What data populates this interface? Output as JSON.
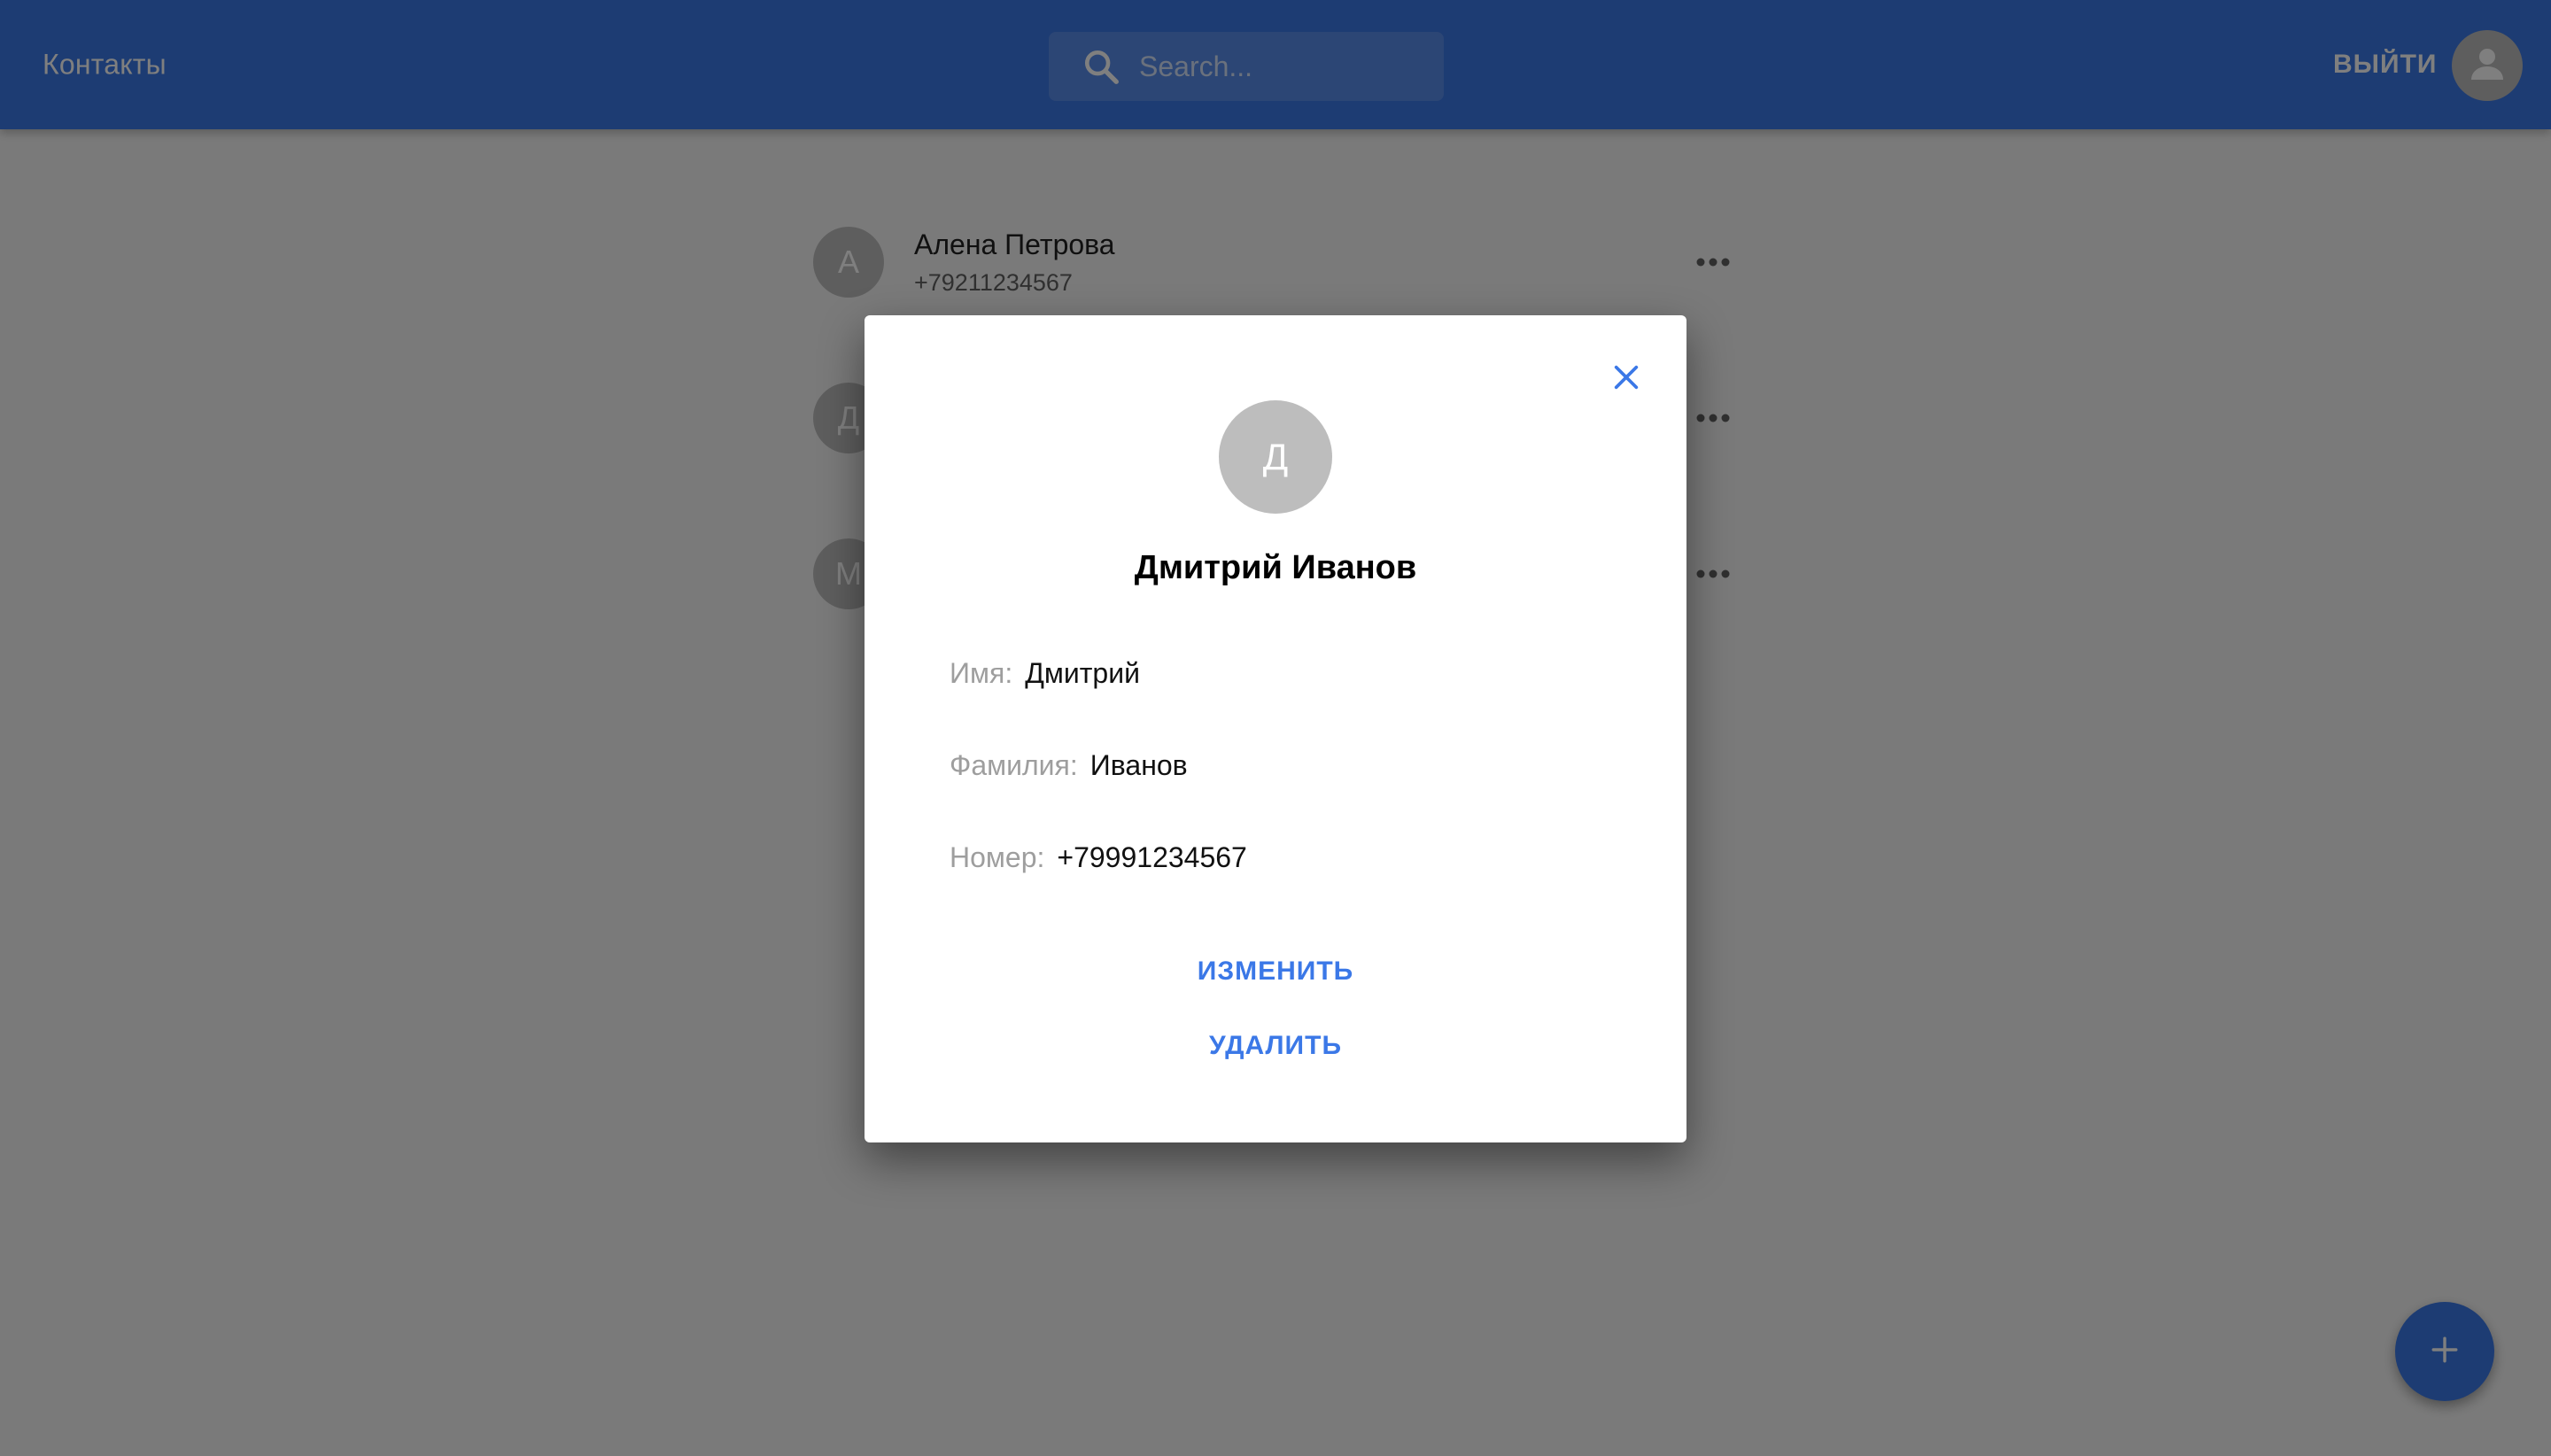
{
  "appbar": {
    "title": "Контакты",
    "search_placeholder": "Search...",
    "logout_label": "ВЫЙТИ"
  },
  "contacts": [
    {
      "initial": "А",
      "name": "Алена Петрова",
      "phone": "+79211234567"
    },
    {
      "initial": "Д",
      "name": "",
      "phone": ""
    },
    {
      "initial": "М",
      "name": "",
      "phone": ""
    }
  ],
  "dialog": {
    "initial": "Д",
    "full_name": "Дмитрий Иванов",
    "fields": [
      {
        "label": "Имя:",
        "value": "Дмитрий"
      },
      {
        "label": "Фамилия:",
        "value": "Иванов"
      },
      {
        "label": "Номер:",
        "value": "+79991234567"
      }
    ],
    "edit_label": "ИЗМЕНИТЬ",
    "delete_label": "УДАЛИТЬ"
  },
  "colors": {
    "primary": "#3b78e7",
    "avatar_bg": "#bdbdbd"
  },
  "icons": [
    "search-icon",
    "account-icon",
    "more-horizontal-icon",
    "close-icon",
    "plus-icon"
  ]
}
